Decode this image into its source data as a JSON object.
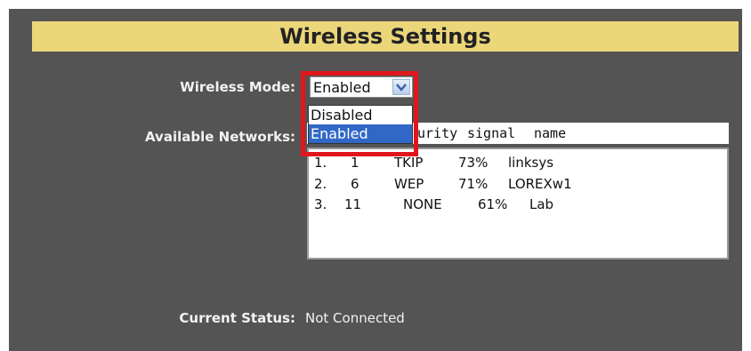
{
  "title": "Wireless Settings",
  "wireless_mode": {
    "label": "Wireless Mode:",
    "selected": "Enabled",
    "options": [
      "Disabled",
      "Enabled"
    ]
  },
  "available_networks": {
    "label": "Available Networks:",
    "header": {
      "security": "urity",
      "signal": "signal",
      "name": "name"
    },
    "rows": [
      {
        "index": "1.",
        "channel": "1",
        "security": "TKIP",
        "signal": "73%",
        "name": "linksys"
      },
      {
        "index": "2.",
        "channel": "6",
        "security": "WEP",
        "signal": "71%",
        "name": "LOREXw1"
      },
      {
        "index": "3.",
        "channel": "11",
        "security": "NONE",
        "signal": "61%",
        "name": "Lab"
      }
    ]
  },
  "current_status": {
    "label": "Current Status:",
    "value": "Not Connected"
  },
  "colors": {
    "panel_bg": "#545454",
    "title_bg": "#ebd67a",
    "highlight": "#e0161c",
    "selected_option": "#3168c6"
  }
}
